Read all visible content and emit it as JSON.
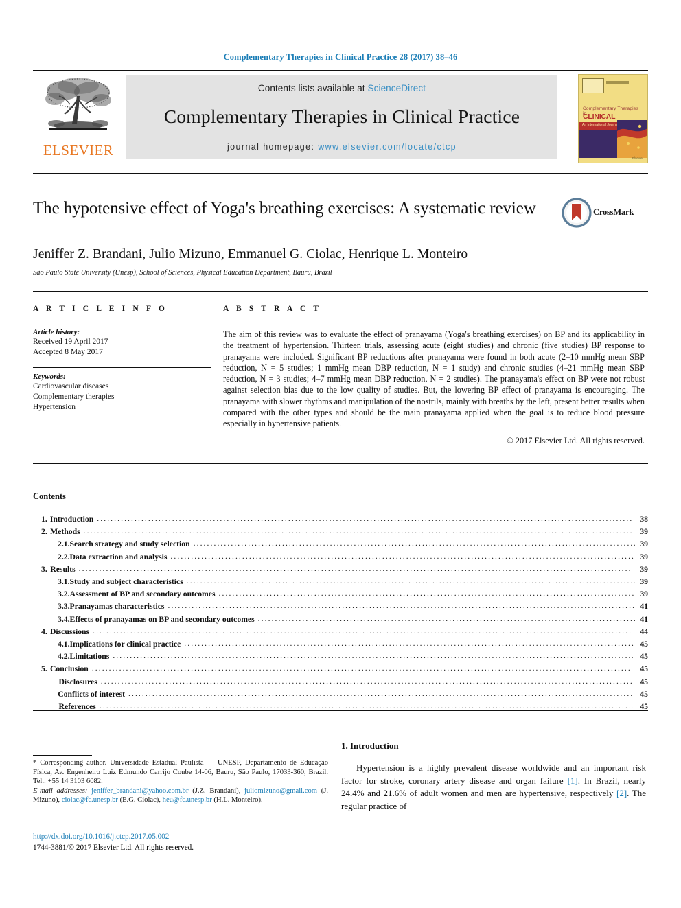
{
  "running_head": "Complementary Therapies in Clinical Practice 28 (2017) 38–46",
  "masthead": {
    "publisher_logo_text": "ELSEVIER",
    "contents_prefix": "Contents lists available at ",
    "sciencedirect": "ScienceDirect",
    "journal_name": "Complementary Therapies in Clinical Practice",
    "homepage_prefix": "journal homepage: ",
    "homepage_url": "www.elsevier.com/locate/ctcp",
    "cover": {
      "line1": "Complementary Therapies in",
      "line2": "CLINICAL PRACTICE",
      "band_text": "An International Journal",
      "top_text": "Complementary Therapies in Clinical Practice",
      "footer": "Elsevier"
    }
  },
  "article": {
    "title": "The hypotensive effect of Yoga's breathing exercises: A systematic review",
    "authors": "Jeniffer Z. Brandani, Julio Mizuno, Emmanuel G. Ciolac, Henrique L. Monteiro",
    "corresponding_marker": "*",
    "affiliation": "São Paulo State University (Unesp), School of Sciences, Physical Education Department, Bauru, Brazil",
    "crossmark_label": "CrossMark"
  },
  "article_info": {
    "heading": "A R T I C L E  I N F O",
    "history_label": "Article history:",
    "history": [
      "Received 19 April 2017",
      "Accepted 8 May 2017"
    ],
    "keywords_label": "Keywords:",
    "keywords": [
      "Cardiovascular diseases",
      "Complementary therapies",
      "Hypertension"
    ]
  },
  "abstract": {
    "heading": "A B S T R A C T",
    "text": "The aim of this review was to evaluate the effect of pranayama (Yoga's breathing exercises) on BP and its applicability in the treatment of hypertension. Thirteen trials, assessing acute (eight studies) and chronic (five studies) BP response to pranayama were included. Significant BP reductions after pranayama were found in both acute (2–10 mmHg mean SBP reduction, N = 5 studies; 1 mmHg mean DBP reduction, N = 1 study) and chronic studies (4–21 mmHg mean SBP reduction, N = 3 studies; 4–7 mmHg mean DBP reduction, N = 2 studies). The pranayama's effect on BP were not robust against selection bias due to the low quality of studies. But, the lowering BP effect of pranayama is encouraging. The pranayama with slower rhythms and manipulation of the nostrils, mainly with breaths by the left, present better results when compared with the other types and should be the main pranayama applied when the goal is to reduce blood pressure especially in hypertensive patients.",
    "copyright": "© 2017 Elsevier Ltd. All rights reserved."
  },
  "contents": {
    "title": "Contents",
    "entries": [
      {
        "num": "1.",
        "level": 1,
        "label": "Introduction",
        "page": "38"
      },
      {
        "num": "2.",
        "level": 1,
        "label": "Methods",
        "page": "39"
      },
      {
        "num": "2.1.",
        "level": 2,
        "label": "Search strategy and study selection",
        "page": "39"
      },
      {
        "num": "2.2.",
        "level": 2,
        "label": "Data extraction and analysis",
        "page": "39"
      },
      {
        "num": "3.",
        "level": 1,
        "label": "Results",
        "page": "39"
      },
      {
        "num": "3.1.",
        "level": 2,
        "label": "Study and subject characteristics",
        "page": "39"
      },
      {
        "num": "3.2.",
        "level": 2,
        "label": "Assessment of BP and secondary outcomes",
        "page": "39"
      },
      {
        "num": "3.3.",
        "level": 2,
        "label": "Pranayamas characteristics",
        "page": "41"
      },
      {
        "num": "3.4.",
        "level": 2,
        "label": "Effects of pranayamas on BP and secondary outcomes",
        "page": "41"
      },
      {
        "num": "4.",
        "level": 1,
        "label": "Discussions",
        "page": "44"
      },
      {
        "num": "4.1.",
        "level": 2,
        "label": "Implications for clinical practice",
        "page": "45"
      },
      {
        "num": "4.2.",
        "level": 2,
        "label": "Limitations",
        "page": "45"
      },
      {
        "num": "5.",
        "level": 1,
        "label": "Conclusion",
        "page": "45"
      },
      {
        "num": "",
        "level": 3,
        "label": "Disclosures",
        "page": "45"
      },
      {
        "num": "",
        "level": 3,
        "label": "Conflicts of interest",
        "page": "45"
      },
      {
        "num": "",
        "level": 3,
        "label": "References",
        "page": "45"
      }
    ]
  },
  "footnote": {
    "marker": "*",
    "corresponding": " Corresponding author. Universidade Estadual Paulista — UNESP, Departamento de Educação Física, Av. Engenheiro Luiz Edmundo Carrijo Coube 14-06, Bauru, São Paulo, 17033-360, Brazil. Tel.: +55 14 3103 6082.",
    "email_label": "E-mail addresses:",
    "emails": [
      {
        "address": "jeniffer_brandani@yahoo.com.br",
        "owner": "(J.Z. Brandani)"
      },
      {
        "address": "juliomizuno@gmail.com",
        "owner": "(J. Mizuno)"
      },
      {
        "address": "ciolac@fc.unesp.br",
        "owner": "(E.G. Ciolac)"
      },
      {
        "address": "heu@fc.unesp.br",
        "owner": "(H.L. Monteiro)"
      }
    ],
    "doi": "http://dx.doi.org/10.1016/j.ctcp.2017.05.002",
    "issn_copyright": "1744-3881/© 2017 Elsevier Ltd. All rights reserved."
  },
  "introduction": {
    "heading": "1. Introduction",
    "paragraph_part1": "Hypertension is a highly prevalent disease worldwide and an important risk factor for stroke, coronary artery disease and organ failure ",
    "ref1": "[1]",
    "paragraph_part2": ". In Brazil, nearly 24.4% and 21.6% of adult women and men are hypertensive, respectively ",
    "ref2": "[2]",
    "paragraph_part3": ". The regular practice of"
  },
  "colors": {
    "link": "#1a7db6",
    "elsevier_orange": "#E87722",
    "band_grey": "#e3e3e3"
  }
}
